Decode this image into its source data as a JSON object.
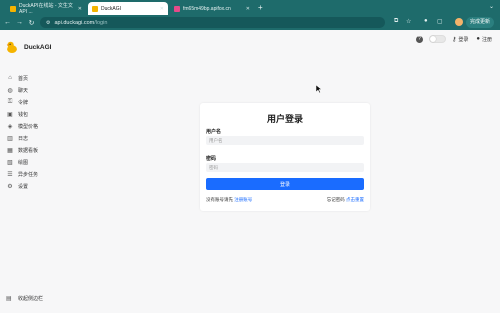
{
  "browser": {
    "tabs": [
      {
        "title": "DuckAPI在线站 - 文生文 API ...",
        "active": false,
        "color": "#f5b400"
      },
      {
        "title": "DuckAGI",
        "active": true,
        "color": "#f5b400"
      },
      {
        "title": "fm65m49bp.apifox.cn",
        "active": false,
        "color": "#e54b8a"
      }
    ],
    "new_tab": "+",
    "url_host": "api.duckagi.com",
    "url_path": "/login",
    "finish_button": "完成更新"
  },
  "app": {
    "brand": "DuckAGI",
    "nav": [
      {
        "icon": "home-icon",
        "glyph": "⌂",
        "label": "首页"
      },
      {
        "icon": "chat-icon",
        "glyph": "◍",
        "label": "聊天"
      },
      {
        "icon": "key-icon",
        "glyph": "⚿",
        "label": "令牌"
      },
      {
        "icon": "wallet-icon",
        "glyph": "▣",
        "label": "钱包"
      },
      {
        "icon": "price-tag-icon",
        "glyph": "◈",
        "label": "模型价格"
      },
      {
        "icon": "log-icon",
        "glyph": "▥",
        "label": "日志"
      },
      {
        "icon": "dashboard-icon",
        "glyph": "▦",
        "label": "数据看板"
      },
      {
        "icon": "image-icon",
        "glyph": "▧",
        "label": "绘图"
      },
      {
        "icon": "task-icon",
        "glyph": "☰",
        "label": "异步任务"
      },
      {
        "icon": "settings-icon",
        "glyph": "⚙",
        "label": "设置"
      }
    ],
    "collapse_label": "收起侧边栏",
    "top": {
      "login": "登录",
      "register": "注册"
    }
  },
  "login": {
    "title": "用户登录",
    "username_label": "用户名",
    "username_placeholder": "用户名",
    "password_label": "密码",
    "password_placeholder": "密码",
    "submit": "登录",
    "no_account": "没有账号请先",
    "register_link": "注册账号",
    "forgot": "忘记密码",
    "reset_link": "点击重置"
  },
  "colors": {
    "primary": "#1a6cff",
    "tabbar": "#1e6b6b"
  }
}
